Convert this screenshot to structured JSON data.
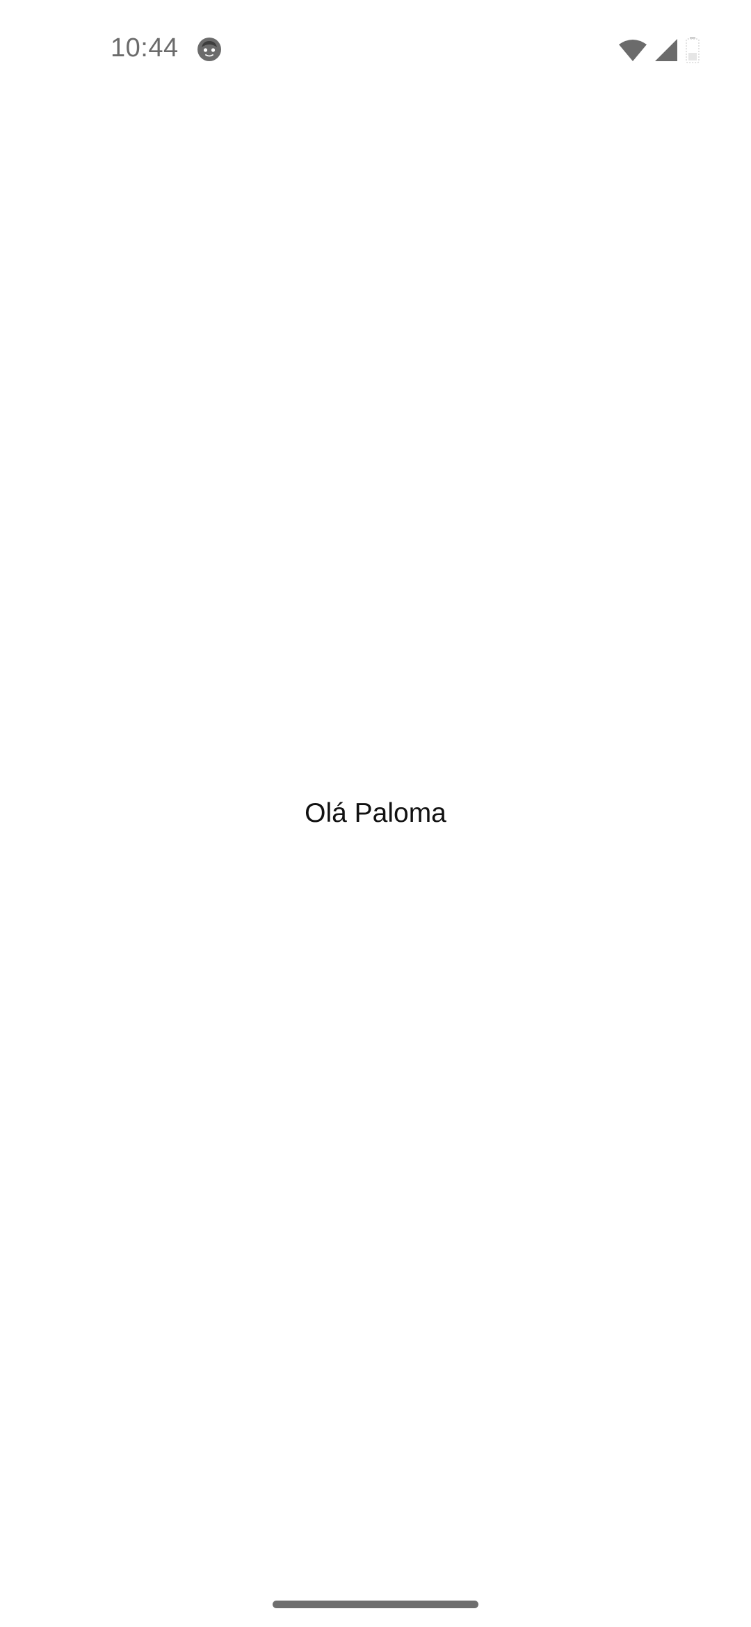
{
  "status_bar": {
    "time": "10:44",
    "icons": [
      "face-notification-icon",
      "wifi-icon",
      "cellular-signal-icon",
      "battery-icon"
    ]
  },
  "main": {
    "greeting": "Olá Paloma"
  },
  "colors": {
    "background": "#ffffff",
    "status_icon": "#6b6b6b",
    "text": "#111111",
    "home_indicator": "#6e6e6e"
  }
}
